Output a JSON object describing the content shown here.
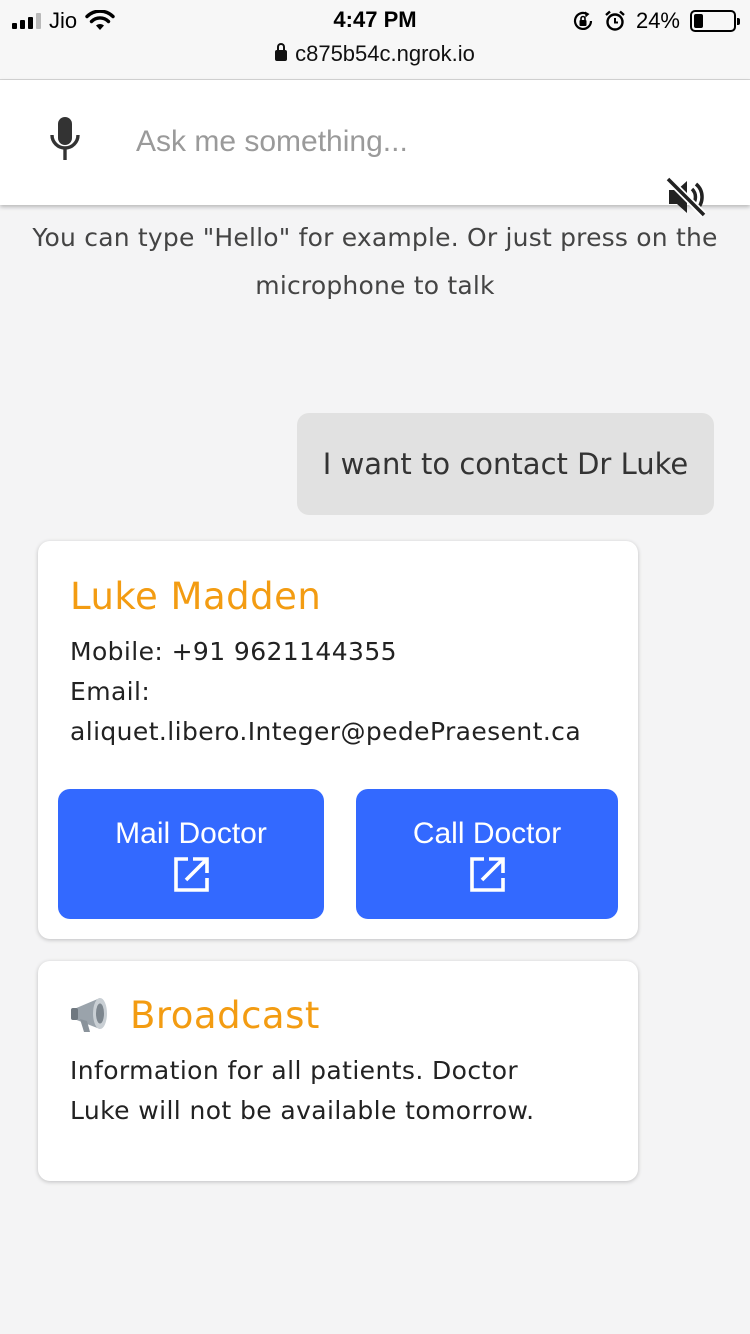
{
  "status_bar": {
    "carrier": "Jio",
    "time": "4:47 PM",
    "url": "c875b54c.ngrok.io",
    "battery": "24%",
    "battery_level": 0.24
  },
  "search": {
    "placeholder": "Ask me something..."
  },
  "hint": "You can type \"Hello\" for example. Or just press on the microphone to talk",
  "user_message": "I want to contact Dr Luke",
  "contact_card": {
    "name": "Luke Madden",
    "mobile": "Mobile: +91 9621144355",
    "email_label": "Email:",
    "email": "aliquet.libero.Integer@pedePraesent.ca",
    "mail_button": "Mail Doctor",
    "call_button": "Call Doctor"
  },
  "broadcast_card": {
    "title": "Broadcast",
    "text": "Information for all patients. Doctor Luke will not be available tomorrow."
  },
  "colors": {
    "accent_orange": "#f39c12",
    "button_blue": "#3369ff",
    "bubble_gray": "#e1e1e1"
  }
}
